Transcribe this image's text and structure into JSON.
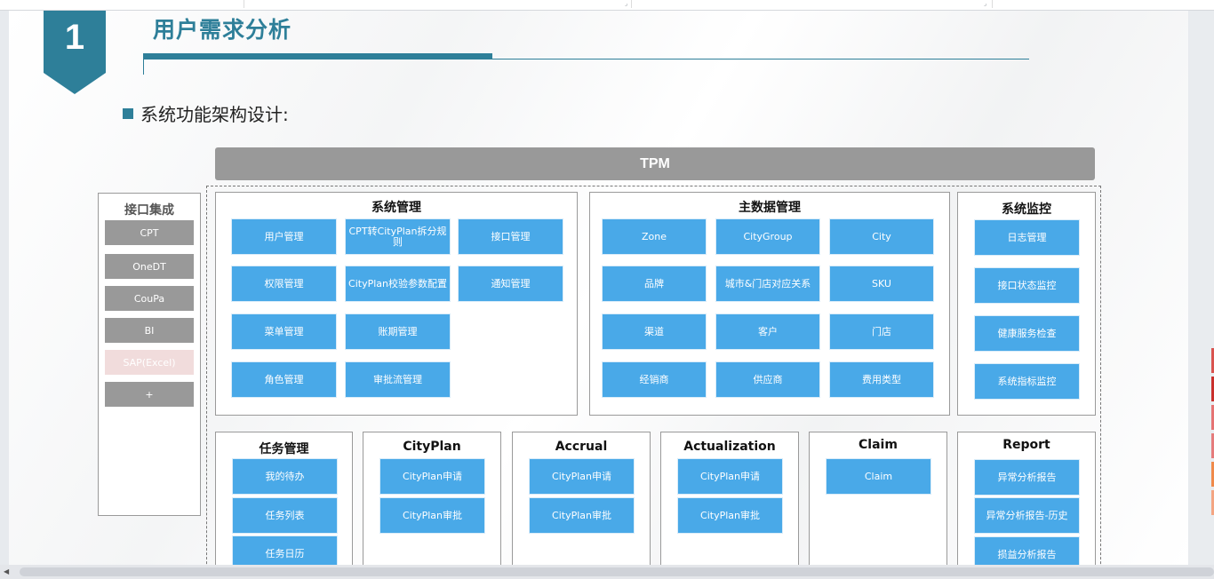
{
  "slide": {
    "section_number": "1",
    "title": "用户需求分析",
    "subtitle": "系统功能架构设计:"
  },
  "diagram": {
    "top_bar": "TPM",
    "interface_integration": {
      "title": "接口集成",
      "items": [
        "CPT",
        "OneDT",
        "CouPa",
        "BI",
        "SAP(Excel)",
        "+"
      ]
    },
    "system_management": {
      "title": "系统管理",
      "items": [
        "用户管理",
        "CPT转CityPlan拆分规则",
        "接口管理",
        "权限管理",
        "CityPlan校验参数配置",
        "通知管理",
        "菜单管理",
        "账期管理",
        "角色管理",
        "审批流管理"
      ]
    },
    "master_data": {
      "title": "主数据管理",
      "items": [
        "Zone",
        "CityGroup",
        "City",
        "品牌",
        "城市&门店对应关系",
        "SKU",
        "渠道",
        "客户",
        "门店",
        "经销商",
        "供应商",
        "费用类型"
      ]
    },
    "monitoring": {
      "title": "系统监控",
      "items": [
        "日志管理",
        "接口状态监控",
        "健康服务检查",
        "系统指标监控"
      ]
    },
    "task_management": {
      "title": "任务管理",
      "items": [
        "我的待办",
        "任务列表",
        "任务日历"
      ]
    },
    "cityplan": {
      "title": "CityPlan",
      "items": [
        "CityPlan申请",
        "CityPlan审批"
      ]
    },
    "accrual": {
      "title": "Accrual",
      "items": [
        "CityPlan申请",
        "CityPlan审批"
      ]
    },
    "actualization": {
      "title": "Actualization",
      "items": [
        "CityPlan申请",
        "CityPlan审批"
      ]
    },
    "claim": {
      "title": "Claim",
      "items": [
        "Claim"
      ]
    },
    "report": {
      "title": "Report",
      "items": [
        "异常分析报告",
        "异常分析报告-历史",
        "损益分析报告"
      ]
    }
  },
  "colors": {
    "accent": "#2e7f99",
    "module_box": "#49a9e8",
    "interface_box": "#999999",
    "interface_box_disabled": "#f1dcdc",
    "tpm_bar": "#999999",
    "swatches": [
      "#d9534f",
      "#c9302c",
      "#e57373",
      "#e57c7c",
      "#f08a4b",
      "#f4a582"
    ]
  }
}
